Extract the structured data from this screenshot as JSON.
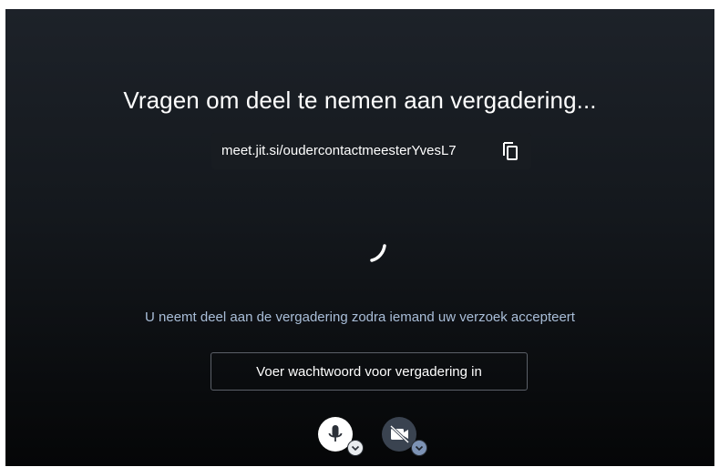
{
  "prejoin": {
    "title": "Vragen om deel te nemen aan vergadering...",
    "meeting_url": "meet.jit.si/oudercontactmeesterYvesL7",
    "status_message": "U neemt deel aan de vergadering zodra iemand uw verzoek accepteert",
    "password_button_label": "Voer wachtwoord voor vergadering in"
  },
  "icons": {
    "copy": "copy-icon",
    "loading": "spinner-icon",
    "microphone": "microphone-icon",
    "camera_off": "camera-off-icon",
    "chevron": "chevron-down-icon"
  },
  "colors": {
    "status_text": "#a9bed8",
    "camera_button": "#3a4350",
    "camera_chevron": "#7d93b5"
  }
}
